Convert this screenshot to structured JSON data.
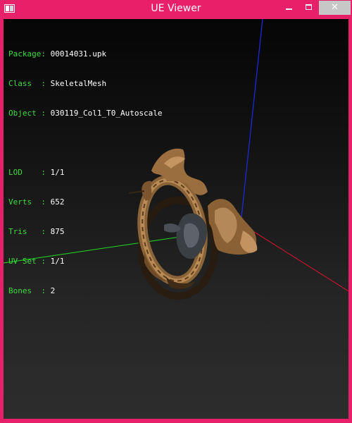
{
  "window": {
    "title": "UE Viewer",
    "buttons": {
      "minimize": "minimize-icon",
      "maximize": "maximize-icon",
      "close": "close-icon"
    },
    "frame_color": "#e8206a"
  },
  "info": {
    "package": {
      "label": "Package:",
      "value": "00014031.upk"
    },
    "class": {
      "label": "Class  :",
      "value": "SkeletalMesh"
    },
    "object": {
      "label": "Object :",
      "value": "030119_Col1_T0_Autoscale"
    },
    "lod": {
      "label": "LOD    :",
      "value": "1/1"
    },
    "verts": {
      "label": "Verts  :",
      "value": "652"
    },
    "tris": {
      "label": "Tris   :",
      "value": "875"
    },
    "uvset": {
      "label": "UV Set :",
      "value": "1/1"
    },
    "bones": {
      "label": "Bones  :",
      "value": "2"
    }
  },
  "axes": {
    "x_color": "#e01030",
    "y_color": "#22dd22",
    "z_color": "#1a2ad8"
  },
  "label_color": "#3ddc3d"
}
